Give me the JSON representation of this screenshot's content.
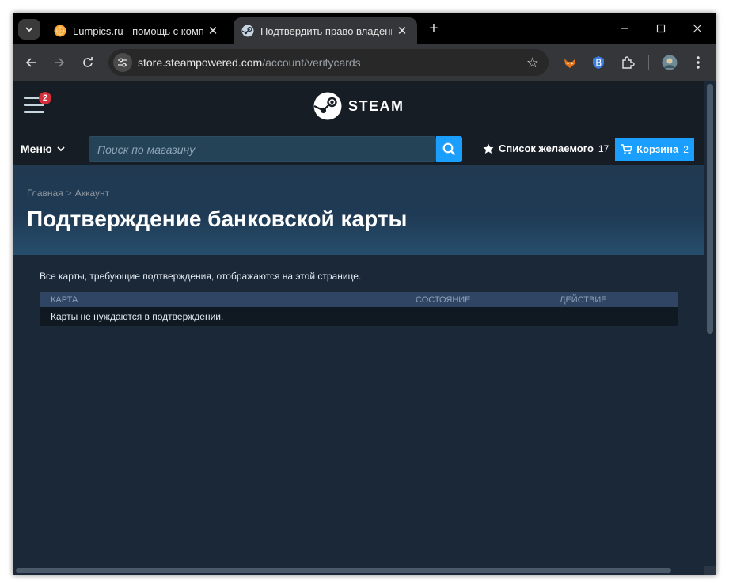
{
  "browser": {
    "tabs": [
      {
        "title": "Lumpics.ru - помощь с компью",
        "active": false,
        "favicon": "lumpics-orange-icon"
      },
      {
        "title": "Подтвердить право владения к",
        "active": true,
        "favicon": "steam-icon"
      }
    ],
    "new_tab_symbol": "+",
    "address": {
      "host": "store.steampowered.com",
      "path": "/account/verifycards"
    },
    "extensions": [
      "fox-extension-icon",
      "shield-extension-icon",
      "puzzle-extensions-icon",
      "profile-avatar-icon"
    ]
  },
  "steam": {
    "notification_count": "2",
    "logo_text": "STEAM",
    "nav": {
      "menu_label": "Меню",
      "search_placeholder": "Поиск по магазину",
      "wishlist_label": "Список желаемого",
      "wishlist_count": "17",
      "cart_label": "Корзина",
      "cart_count": "2"
    },
    "breadcrumb": [
      {
        "label": "Главная"
      },
      {
        "label": "Аккаунт"
      }
    ],
    "breadcrumb_sep": ">",
    "page_title": "Подтверждение банковской карты",
    "intro_text": "Все карты, требующие подтверждения, отображаются на этой странице.",
    "table": {
      "columns": [
        "Карта",
        "Состояние",
        "Действие"
      ],
      "empty_message": "Карты не нуждаются в подтверждении."
    }
  },
  "colors": {
    "steam_bg": "#1b2838",
    "steam_header": "#171d25",
    "accent_blue": "#1a9fff",
    "badge_red": "#d12f3a"
  }
}
